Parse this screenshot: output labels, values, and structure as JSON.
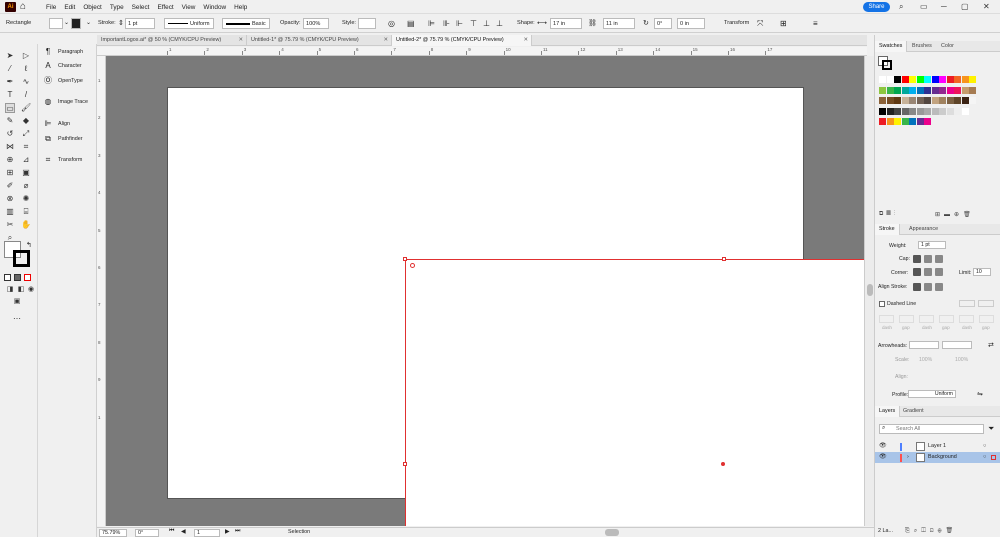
{
  "app": {
    "logo": "Ai",
    "share_label": "Share"
  },
  "menu": [
    "File",
    "Edit",
    "Object",
    "Type",
    "Select",
    "Effect",
    "View",
    "Window",
    "Help"
  ],
  "control_bar": {
    "tool_name": "Rectangle",
    "stroke_label": "Stroke:",
    "stroke_weight": "1 pt",
    "profile": "Uniform",
    "brush": "Basic",
    "opacity_label": "Opacity:",
    "opacity": "100%",
    "style_label": "Style:",
    "shape_label": "Shape:",
    "width": "17 in",
    "height": "11 in",
    "angle": "0°",
    "corner": "0 in",
    "transform_label": "Transform"
  },
  "doc_tabs": [
    {
      "label": "ImportantLogos.ai* @ 50 % (CMYK/CPU Preview)",
      "active": false
    },
    {
      "label": "Untitled-1* @ 75.79 % (CMYK/CPU Preview)",
      "active": false
    },
    {
      "label": "Untitled-2* @ 75.79 % (CMYK/CPU Preview)",
      "active": true
    }
  ],
  "dock_panels": [
    {
      "icon": "paragraph-icon",
      "label": "Paragraph"
    },
    {
      "icon": "character-icon",
      "label": "Character"
    },
    {
      "icon": "opentype-icon",
      "label": "OpenType"
    },
    {
      "icon": "image-trace-icon",
      "label": "Image Trace"
    },
    {
      "icon": "align-icon",
      "label": "Align"
    },
    {
      "icon": "pathfinder-icon",
      "label": "Pathfinder"
    },
    {
      "icon": "transform-icon",
      "label": "Transform"
    }
  ],
  "ruler_top": [
    "1",
    "2",
    "3",
    "4",
    "5",
    "6",
    "7",
    "8",
    "9",
    "10",
    "11",
    "12",
    "13",
    "14",
    "15",
    "16",
    "17"
  ],
  "ruler_left": [
    "1",
    "2",
    "3",
    "4",
    "5",
    "6",
    "7",
    "8",
    "9",
    "1"
  ],
  "status": {
    "zoom": "75.79%",
    "rotation": "0°",
    "artboard": "1",
    "tool": "Selection"
  },
  "panels": {
    "swatch_tabs": [
      "Swatches",
      "Brushes",
      "Color"
    ],
    "stroke_tabs": [
      "Stroke",
      "Appearance"
    ],
    "weight_label": "Weight:",
    "weight": "1 pt",
    "cap_label": "Cap:",
    "corner_label": "Corner:",
    "limit_label": "Limit:",
    "limit": "10",
    "align_stroke_label": "Align Stroke:",
    "dashed_line_label": "Dashed Line",
    "dash_labels": [
      "dash",
      "gap",
      "dash",
      "gap",
      "dash",
      "gap"
    ],
    "arrowheads_label": "Arrowheads:",
    "scale_label": "Scale:",
    "scale1": "100%",
    "scale2": "100%",
    "align_label": "Align:",
    "profile_label": "Profile:",
    "profile": "Uniform",
    "layer_tabs": [
      "Layers",
      "Gradient"
    ],
    "search_placeholder": "Search All",
    "layers": [
      {
        "name": "Layer 1",
        "color": "#4f80ff",
        "selected": false
      },
      {
        "name": "Background",
        "color": "#ff4f4f",
        "selected": true
      }
    ],
    "layer_count": "2 La..."
  },
  "swatch_colors": [
    [
      "#ffffff",
      "#ffffff",
      "#000000",
      "#ff0000",
      "#ffff00",
      "#00ff00",
      "#00ffff",
      "#0000ff",
      "#ff00ff",
      "#ed1c24",
      "#f26522",
      "#f7941d",
      "#fff200"
    ],
    [
      "#8dc63f",
      "#39b54a",
      "#00a651",
      "#00a99d",
      "#00aeef",
      "#0072bc",
      "#2e3192",
      "#662d91",
      "#92278f",
      "#ec008c",
      "#ed145b",
      "#c69c6d",
      "#a67c52"
    ],
    [
      "#8c6239",
      "#754c24",
      "#603913",
      "#c7b299",
      "#998675",
      "#736357",
      "#534741",
      "#c2a37f",
      "#a0825f",
      "#7c6143",
      "#5e4428",
      "#3b2314",
      "#f5f5f5"
    ],
    [
      "#000000",
      "#222222",
      "#444444",
      "#666666",
      "#888888",
      "#999999",
      "#aaaaaa",
      "#bbbbbb",
      "#cccccc",
      "#dddddd",
      "#eeeeee",
      "#ffffff"
    ],
    [
      "#ed1c24",
      "#f7941d",
      "#fff200",
      "#39b54a",
      "#0072bc",
      "#662d91",
      "#ec008c"
    ]
  ]
}
